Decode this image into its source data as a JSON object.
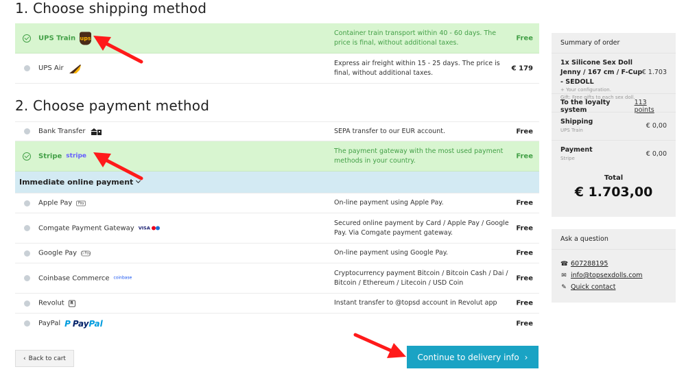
{
  "shipping": {
    "heading": "1. Choose shipping method",
    "methods": [
      {
        "name": "UPS Train",
        "icon": "ups-logo-icon",
        "desc": "Container train transport within 40 - 60 days. The price is final, without additional taxes.",
        "price": "Free",
        "selected": true
      },
      {
        "name": "UPS Air",
        "icon": "airplane-icon",
        "desc": "Express air freight within 15 - 25 days. The price is final, without additional taxes.",
        "price": "€ 179",
        "selected": false
      }
    ]
  },
  "payment": {
    "heading": "2. Choose payment method",
    "methods": [
      {
        "name": "Bank Transfer",
        "desc": "SEPA transfer to our EUR account.",
        "price": "Free"
      },
      {
        "name": "Stripe",
        "brand": "stripe",
        "desc": "The payment gateway with the most used payment methods in your country.",
        "price": "Free",
        "selected": true
      }
    ],
    "immediate_label": "Immediate online payment",
    "online": [
      {
        "name": "Apple Pay",
        "badge": "Pay",
        "desc": "On-line payment using Apple Pay.",
        "price": "Free"
      },
      {
        "name": "Comgate Payment Gateway",
        "badge": "VISA",
        "desc": "Secured online payment by Card / Apple Pay / Google Pay. Via Comgate payment gateway.",
        "price": "Free"
      },
      {
        "name": "Google Pay",
        "badge": "G Pay",
        "desc": "On-line payment using Google Pay.",
        "price": "Free"
      },
      {
        "name": "Coinbase Commerce",
        "badge": "coinbase",
        "desc": "Cryptocurrency payment Bitcoin / Bitcoin Cash / Dai / Bitcoin / Ethereum / Litecoin / USD Coin",
        "price": "Free"
      },
      {
        "name": "Revolut",
        "badge": "R",
        "desc": "Instant transfer to @topsd account in Revolut app",
        "price": "Free"
      },
      {
        "name": "PayPal",
        "badge_a": "Pay",
        "badge_b": "Pal",
        "desc": "",
        "price": "Free"
      }
    ]
  },
  "buttons": {
    "back": "Back to cart",
    "back_arrow": "‹",
    "continue": "Continue to delivery info",
    "continue_arrow": "›"
  },
  "summary": {
    "heading": "Summary of order",
    "item_title": "1x Silicone Sex Doll Jenny / 167 cm / F-Cup - SEDOLL",
    "item_price": "€ 1.703",
    "item_config": "+ Your configuration.",
    "item_gift": "Gift: Free gifts to each sex doll.",
    "loyalty_label": "To the loyalty system",
    "loyalty_points": "113 points",
    "shipping_label": "Shipping",
    "shipping_sub": "UPS Train",
    "shipping_price": "€ 0,00",
    "payment_label": "Payment",
    "payment_sub": "Stripe",
    "payment_price": "€ 0,00",
    "total_label": "Total",
    "total_value": "€ 1.703,00"
  },
  "ask": {
    "heading": "Ask a question",
    "phone": "607288195",
    "email": "info@topsexdolls.com",
    "contact": "Quick contact"
  },
  "colors": {
    "selected_bg": "#d8f5d0",
    "selected_text": "#43a047",
    "immediate_bg": "#d3eaf3",
    "continue_bg": "#1aa3c4",
    "arrow": "#ff1a1a"
  }
}
